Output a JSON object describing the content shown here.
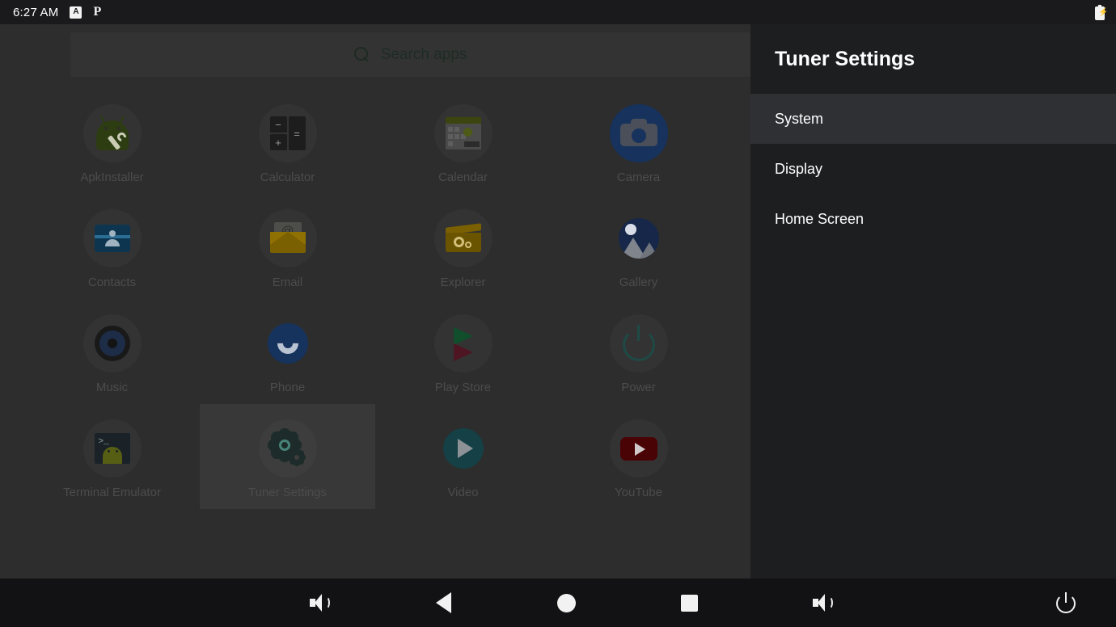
{
  "statusbar": {
    "clock": "6:27 AM",
    "keyboard_indicator": "A",
    "app_indicator": "P",
    "battery_icon": "battery-charging-icon"
  },
  "drawer": {
    "search": {
      "placeholder": "Search apps",
      "icon": "search-icon"
    },
    "apps": [
      {
        "label": "ApkInstaller",
        "icon": "apkinstaller-icon",
        "selected": false
      },
      {
        "label": "Calculator",
        "icon": "calculator-icon",
        "selected": false
      },
      {
        "label": "Calendar",
        "icon": "calendar-icon",
        "selected": false
      },
      {
        "label": "Camera",
        "icon": "camera-icon",
        "selected": false
      },
      {
        "label": "Contacts",
        "icon": "contacts-icon",
        "selected": false
      },
      {
        "label": "Email",
        "icon": "email-icon",
        "selected": false
      },
      {
        "label": "Explorer",
        "icon": "explorer-icon",
        "selected": false
      },
      {
        "label": "Gallery",
        "icon": "gallery-icon",
        "selected": false
      },
      {
        "label": "Music",
        "icon": "music-icon",
        "selected": false
      },
      {
        "label": "Phone",
        "icon": "phone-icon",
        "selected": false
      },
      {
        "label": "Play Store",
        "icon": "play-store-icon",
        "selected": false
      },
      {
        "label": "Power",
        "icon": "power-icon",
        "selected": false
      },
      {
        "label": "Terminal Emulator",
        "icon": "terminal-emulator-icon",
        "selected": false
      },
      {
        "label": "Tuner Settings",
        "icon": "tuner-settings-icon",
        "selected": true
      },
      {
        "label": "Video",
        "icon": "video-icon",
        "selected": false
      },
      {
        "label": "YouTube",
        "icon": "youtube-icon",
        "selected": false
      }
    ],
    "calculator_keys": {
      "minus": "−",
      "plus": "+",
      "equals": "="
    },
    "terminal_prompt": ">_"
  },
  "panel": {
    "title": "Tuner Settings",
    "items": [
      {
        "label": "System",
        "active": true
      },
      {
        "label": "Display",
        "active": false
      },
      {
        "label": "Home Screen",
        "active": false
      }
    ]
  },
  "navbar": {
    "left": [
      {
        "name": "volume-icon",
        "label": "Volume"
      },
      {
        "name": "back-icon",
        "label": "Back"
      },
      {
        "name": "home-icon",
        "label": "Home"
      },
      {
        "name": "recents-icon",
        "label": "Recents"
      }
    ],
    "right": [
      {
        "name": "volume-icon",
        "label": "Volume"
      },
      {
        "name": "power-icon",
        "label": "Power"
      }
    ]
  },
  "colors": {
    "scrim_background": "#2d2d2d",
    "panel_background": "#1d1e20",
    "panel_active_row": "#2e3034",
    "selected_tile": "#383838",
    "navbar": "#121214",
    "statusbar": "#1a1a1c",
    "text_primary": "#ffffff",
    "text_dimmed": "#4c4c4c"
  }
}
